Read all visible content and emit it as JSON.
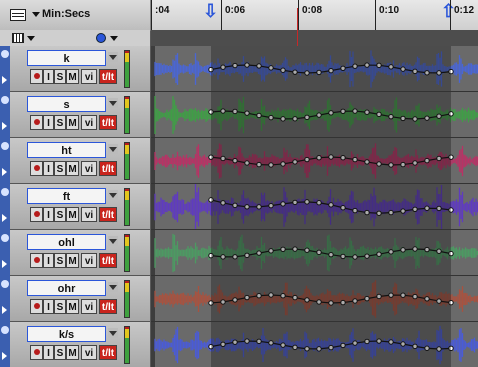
{
  "ruler": {
    "label": "Min:Secs",
    "ticks": [
      ":04",
      "0:06",
      "0:08",
      "0:10",
      "0:12"
    ]
  },
  "icons": {
    "edit_menu": "menu-icon",
    "view_grid": "grid-icon",
    "timebase": "clock-icon",
    "start_marker": "down-arrow-marker",
    "end_marker": "up-arrow-marker"
  },
  "buttons": {
    "input": "I",
    "solo": "S",
    "mute": "M",
    "vi": "vi",
    "tlt": "t/lt"
  },
  "tracks": [
    {
      "name": "k",
      "color": "#4a66d4"
    },
    {
      "name": "s",
      "color": "#3f9e46"
    },
    {
      "name": "ht",
      "color": "#b93265"
    },
    {
      "name": "ft",
      "color": "#5f3bc0"
    },
    {
      "name": "ohl",
      "color": "#4c9a62"
    },
    {
      "name": "ohr",
      "color": "#a8523f"
    },
    {
      "name": "k/s",
      "color": "#4a5bd6"
    }
  ],
  "colors": {
    "accent": "#2b56d9",
    "playhead": "#c62828",
    "tlt_button": "#c9241d"
  }
}
